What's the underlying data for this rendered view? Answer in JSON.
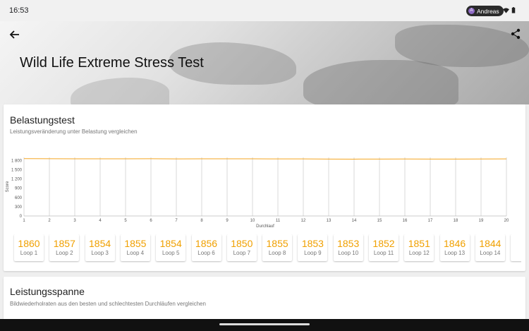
{
  "status_bar": {
    "time": "16:53",
    "user": "Andreas",
    "avatar_letter": "A"
  },
  "header": {
    "title": "Wild Life Extreme Stress Test"
  },
  "stress_test": {
    "title": "Belastungstest",
    "subtitle": "Leistungsveränderung unter Belastung vergleichen"
  },
  "chart_data": {
    "type": "line",
    "xlabel": "Durchlauf",
    "ylabel": "Score",
    "x": [
      1,
      2,
      3,
      4,
      5,
      6,
      7,
      8,
      9,
      10,
      11,
      12,
      13,
      14,
      15,
      16,
      17,
      18,
      19,
      20
    ],
    "ylim": [
      0,
      1900
    ],
    "y_ticks": [
      "0",
      "300",
      "600",
      "900",
      "1 200",
      "1 500",
      "1 800"
    ],
    "series": [
      {
        "values": [
          1860,
          1857,
          1854,
          1855,
          1854,
          1856,
          1850,
          1855,
          1853,
          1853,
          1852,
          1851,
          1846,
          1844,
          1846,
          1848,
          1846,
          1847,
          1848,
          1850
        ],
        "color": "#f5a623"
      }
    ],
    "grid": "vertical"
  },
  "loops": [
    {
      "score": "1860",
      "label": "Loop 1"
    },
    {
      "score": "1857",
      "label": "Loop 2"
    },
    {
      "score": "1854",
      "label": "Loop 3"
    },
    {
      "score": "1855",
      "label": "Loop 4"
    },
    {
      "score": "1854",
      "label": "Loop 5"
    },
    {
      "score": "1856",
      "label": "Loop 6"
    },
    {
      "score": "1850",
      "label": "Loop 7"
    },
    {
      "score": "1855",
      "label": "Loop 8"
    },
    {
      "score": "1853",
      "label": "Loop 9"
    },
    {
      "score": "1853",
      "label": "Loop 10"
    },
    {
      "score": "1852",
      "label": "Loop 11"
    },
    {
      "score": "1851",
      "label": "Loop 12"
    },
    {
      "score": "1846",
      "label": "Loop 13"
    },
    {
      "score": "1844",
      "label": "Loop 14"
    },
    {
      "score": "1",
      "label": ""
    }
  ],
  "range": {
    "title": "Leistungsspanne",
    "subtitle": "Bildwiederholraten aus den besten und schlechtesten Durchläufen vergleichen"
  },
  "colors": {
    "accent": "#f5a623",
    "score_text": "#f0a000"
  }
}
